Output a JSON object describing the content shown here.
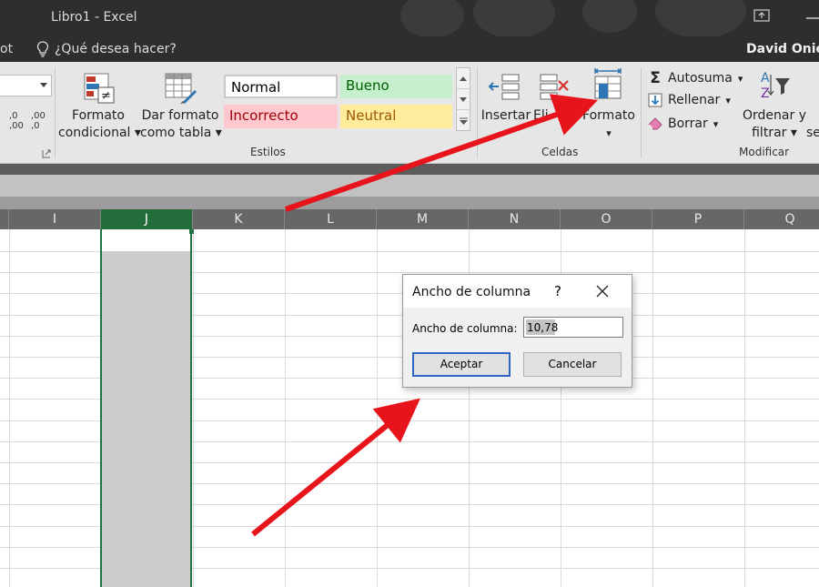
{
  "window": {
    "title": "Libro1  -  Excel",
    "tab_partial": "ot",
    "tell_me": "¿Qué desea hacer?",
    "user": "David Onieva"
  },
  "ribbon": {
    "number": {
      "increase_decimals": ",0 ,00",
      "decrease_decimals": ",00 ,0"
    },
    "styles": {
      "conditional_format_line1": "Formato",
      "conditional_format_line2": "condicional",
      "format_as_table_line1": "Dar formato",
      "format_as_table_line2": "como tabla",
      "normal": "Normal",
      "bueno": "Bueno",
      "incorrecto": "Incorrecto",
      "neutral": "Neutral",
      "group_label": "Estilos"
    },
    "cells": {
      "insert": "Insertar",
      "delete_partial": "Eli",
      "delete_partial_end": "ar",
      "format": "Formato",
      "group_label": "Celdas"
    },
    "editing": {
      "autosum": "Autosuma",
      "fill": "Rellenar",
      "clear": "Borrar",
      "sort_filter_line1": "Ordenar y",
      "sort_filter_line2": "filtrar",
      "find_partial": "se",
      "group_label": "Modificar"
    }
  },
  "columns": [
    "I",
    "J",
    "K",
    "L",
    "M",
    "N",
    "O",
    "P",
    "Q"
  ],
  "selected_column": "J",
  "dialog": {
    "title": "Ancho de columna",
    "help": "?",
    "field_label": "Ancho de columna:",
    "value": "10,78",
    "ok": "Aceptar",
    "cancel": "Cancelar"
  },
  "colors": {
    "accent_green": "#217346",
    "arrow_red": "#e8141c",
    "dialog_default_border": "#2f66c4"
  },
  "icons": [
    "lightbulb-icon",
    "conditional-format-icon",
    "format-as-table-icon",
    "insert-cells-icon",
    "delete-cells-icon",
    "format-cells-icon",
    "sigma-icon",
    "fill-down-icon",
    "eraser-icon",
    "sort-filter-icon",
    "close-icon",
    "help-icon",
    "dropdown-arrow-icon"
  ]
}
